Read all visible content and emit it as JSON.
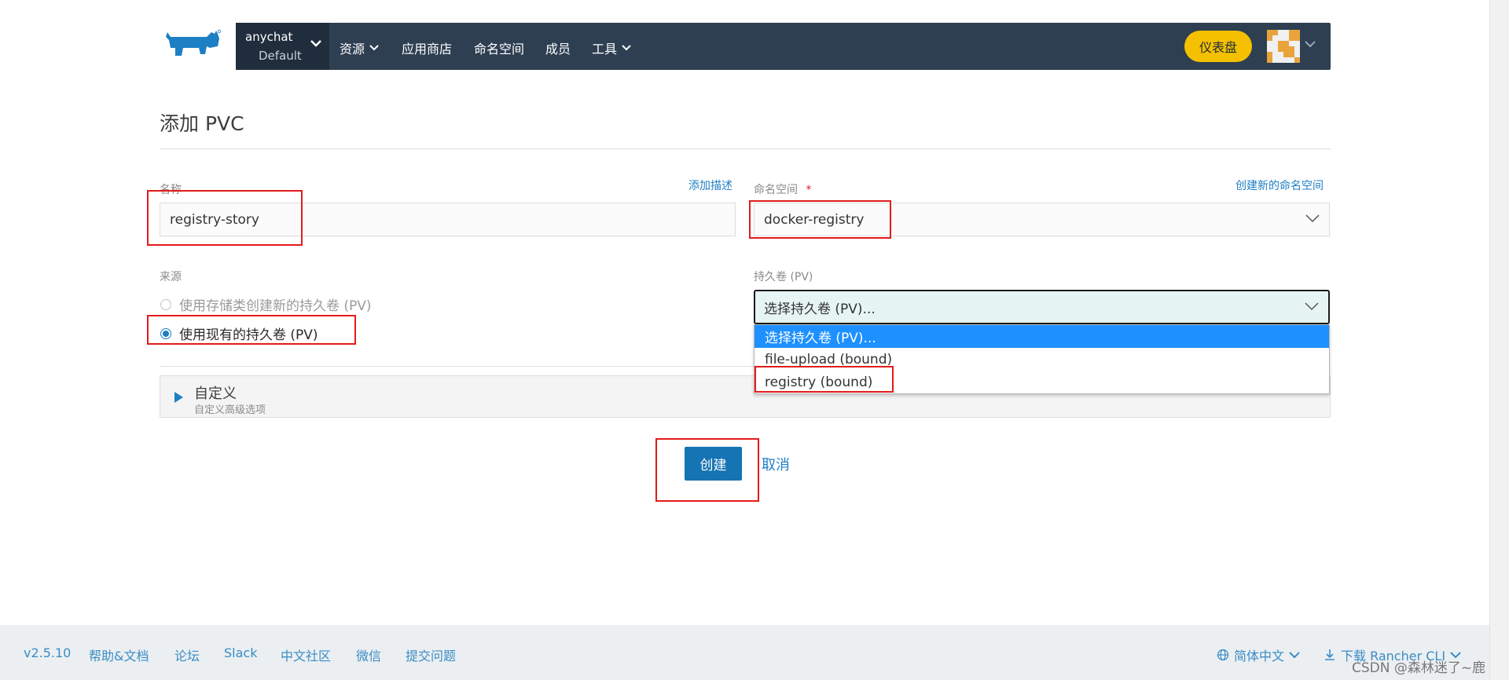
{
  "header": {
    "cluster_name": "anychat",
    "project_name": "Default",
    "nav": [
      "资源",
      "应用商店",
      "命名空间",
      "成员",
      "工具"
    ],
    "dashboard_label": "仪表盘"
  },
  "page": {
    "title": "添加 PVC"
  },
  "form": {
    "name_label": "名称",
    "add_description": "添加描述",
    "name_value": "registry-story",
    "namespace_label": "命名空间",
    "required_mark": "*",
    "create_namespace": "创建新的命名空间",
    "namespace_value": "docker-registry",
    "source_label": "来源",
    "source_options": [
      "使用存储类创建新的持久卷 (PV)",
      "使用现有的持久卷 (PV)"
    ],
    "selected_source": 1,
    "pv_label": "持久卷 (PV)",
    "pv_value": "选择持久卷 (PV)...",
    "pv_options": [
      "选择持久卷 (PV)...",
      "file-upload (bound)",
      "registry (bound)"
    ],
    "custom_title": "自定义",
    "custom_sub": "自定义高级选项",
    "create_label": "创建",
    "cancel_label": "取消"
  },
  "footer": {
    "version": "v2.5.10",
    "links": [
      "帮助&文档",
      "论坛",
      "Slack",
      "中文社区",
      "微信",
      "提交问题"
    ],
    "language": "简体中文",
    "download": "下载 Rancher CLI",
    "watermark": "CSDN @森林迷了~鹿"
  },
  "colors": {
    "nav_bg": "#2e3f52",
    "accent": "#1d7fc4",
    "dashboard": "#f5c000",
    "highlight": "#e31b1b"
  }
}
